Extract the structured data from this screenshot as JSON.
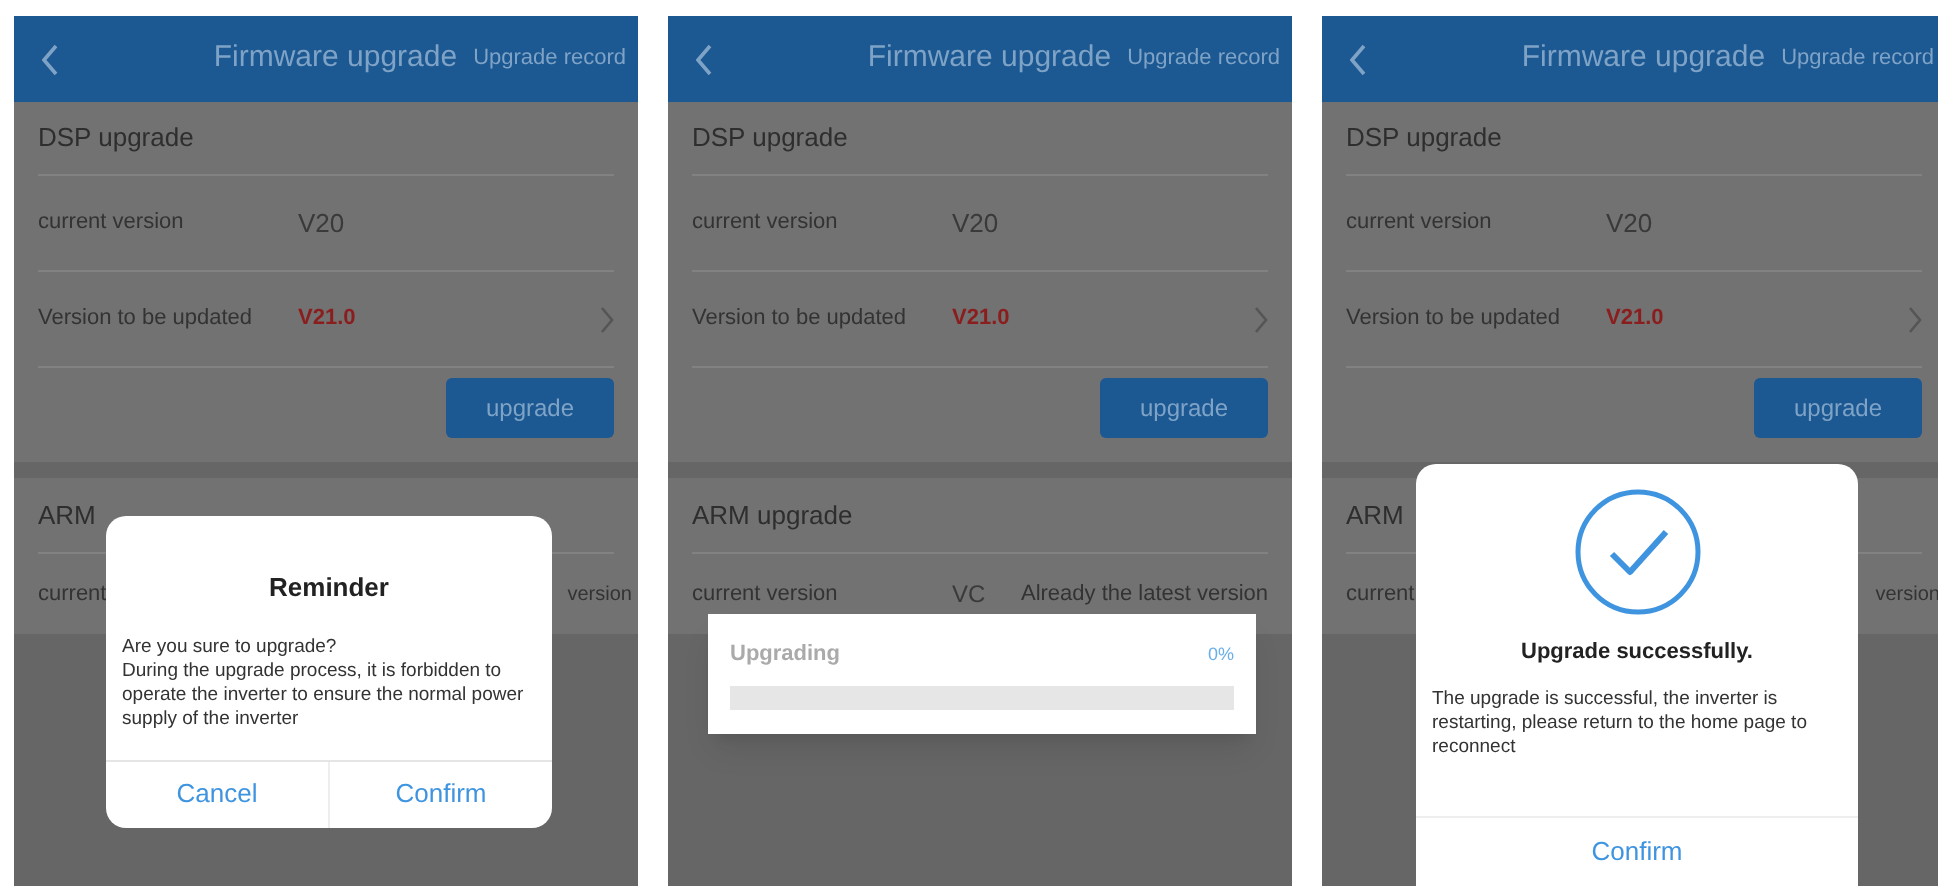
{
  "screens": [
    {
      "header": {
        "title": "Firmware upgrade",
        "action": "Upgrade record"
      },
      "dsp": {
        "title": "DSP upgrade",
        "rows": [
          {
            "label": "current version",
            "value": "V20",
            "highlight": false
          },
          {
            "label": "Version to be updated",
            "value": "V21.0",
            "highlight": true,
            "chevron": true
          }
        ],
        "button": "upgrade"
      },
      "arm": {
        "title": "ARM",
        "rows": [
          {
            "label": "current",
            "status": "version"
          }
        ]
      },
      "dialog": {
        "kind": "confirm",
        "title": "Reminder",
        "lines": [
          "Are you sure to upgrade?",
          "During the upgrade process, it is forbidden to operate the inverter to ensure the normal power supply of the inverter"
        ],
        "buttons": [
          "Cancel",
          "Confirm"
        ]
      }
    },
    {
      "header": {
        "title": "Firmware upgrade",
        "action": "Upgrade record"
      },
      "dsp": {
        "title": "DSP upgrade",
        "rows": [
          {
            "label": "current version",
            "value": "V20",
            "highlight": false
          },
          {
            "label": "Version to be updated",
            "value": "V21.0",
            "highlight": true,
            "chevron": true
          }
        ],
        "button": "upgrade"
      },
      "arm": {
        "title": "ARM upgrade",
        "rows": [
          {
            "label": "current version",
            "value": "VC",
            "status": "Already the latest version"
          }
        ]
      },
      "dialog": {
        "kind": "progress",
        "title": "Upgrading",
        "reading": "0%",
        "level": 0
      }
    },
    {
      "header": {
        "title": "Firmware upgrade",
        "action": "Upgrade record"
      },
      "dsp": {
        "title": "DSP upgrade",
        "rows": [
          {
            "label": "current version",
            "value": "V20",
            "highlight": false
          },
          {
            "label": "Version to be updated",
            "value": "V21.0",
            "highlight": true,
            "chevron": true
          }
        ],
        "button": "upgrade"
      },
      "arm": {
        "title": "ARM",
        "rows": [
          {
            "label": "current",
            "status": "version"
          }
        ]
      },
      "dialog": {
        "kind": "success",
        "title": "Upgrade successfully.",
        "lines": [
          "The upgrade is successful, the inverter is restarting, please return to the home page to reconnect"
        ],
        "buttons": [
          "Confirm"
        ]
      }
    }
  ]
}
